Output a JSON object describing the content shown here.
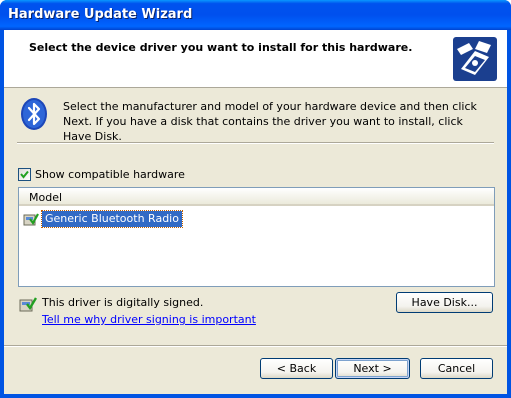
{
  "window": {
    "title": "Hardware Update Wizard"
  },
  "header": {
    "title": "Select the device driver you want to install for this hardware.",
    "icon": "hardware-wizard-icon"
  },
  "body": {
    "icon": "bluetooth-icon",
    "description": "Select the manufacturer and model of your hardware device and then click Next. If you have a disk that contains the driver you want to install, click Have Disk."
  },
  "compatible": {
    "label": "Show compatible hardware",
    "checked": true
  },
  "list": {
    "column_header": "Model",
    "items": [
      {
        "label": "Generic Bluetooth Radio",
        "selected": true,
        "icon": "signed-driver-icon"
      }
    ]
  },
  "signing": {
    "icon": "signed-driver-icon",
    "status": "This driver is digitally signed.",
    "link": "Tell me why driver signing is important"
  },
  "buttons": {
    "have_disk": "Have Disk...",
    "back": "< Back",
    "next": "Next >",
    "cancel": "Cancel"
  }
}
